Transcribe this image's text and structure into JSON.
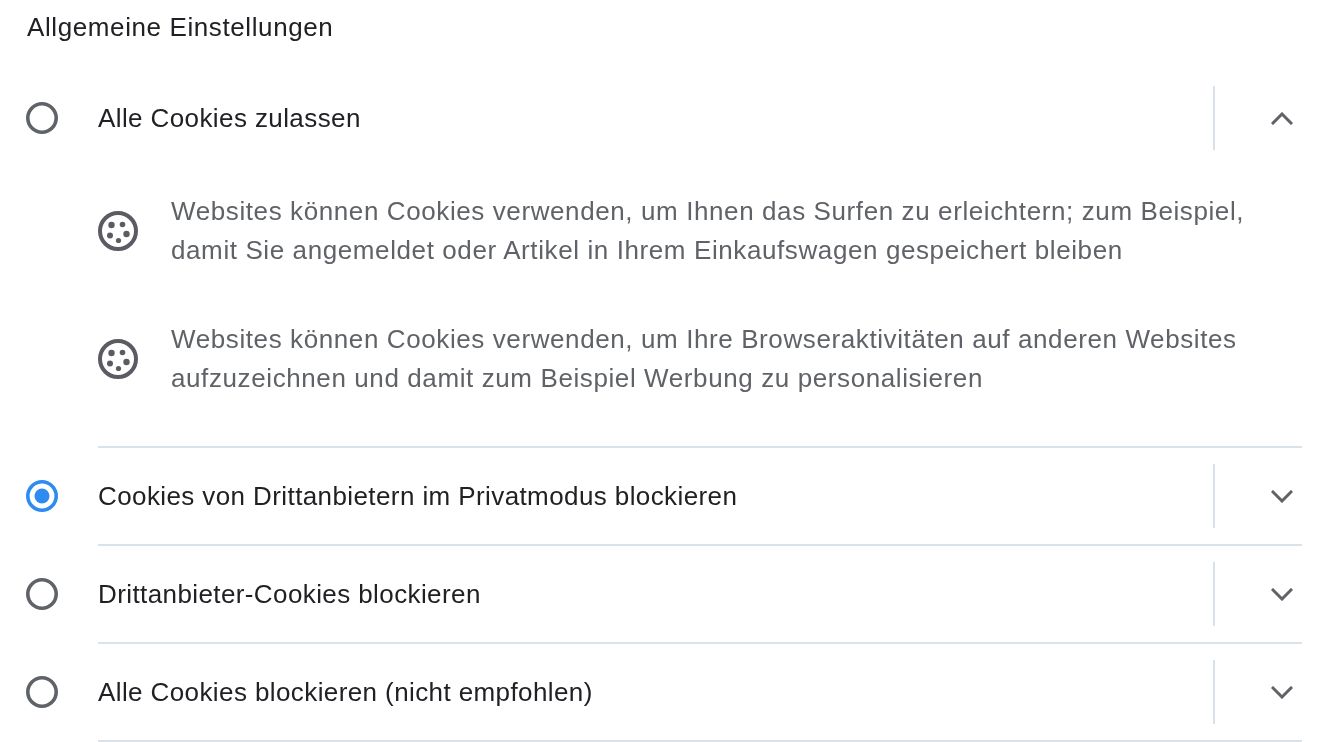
{
  "heading": "Allgemeine Einstellungen",
  "options": [
    {
      "label": "Alle Cookies zulassen",
      "selected": false,
      "expanded": true,
      "details": [
        "Websites können Cookies verwenden, um Ihnen das Surfen zu erleichtern; zum Beispiel, damit Sie angemeldet oder Artikel in Ihrem Einkaufswagen gespeichert bleiben",
        "Websites können Cookies verwenden, um Ihre Browseraktivitäten auf anderen Websites aufzuzeichnen und damit zum Beispiel Werbung zu personalisieren"
      ]
    },
    {
      "label": "Cookies von Drittanbietern im Privatmodus blockieren",
      "selected": true,
      "expanded": false
    },
    {
      "label": "Drittanbieter-Cookies blockieren",
      "selected": false,
      "expanded": false
    },
    {
      "label": "Alle Cookies blockieren (nicht empfohlen)",
      "selected": false,
      "expanded": false
    }
  ]
}
